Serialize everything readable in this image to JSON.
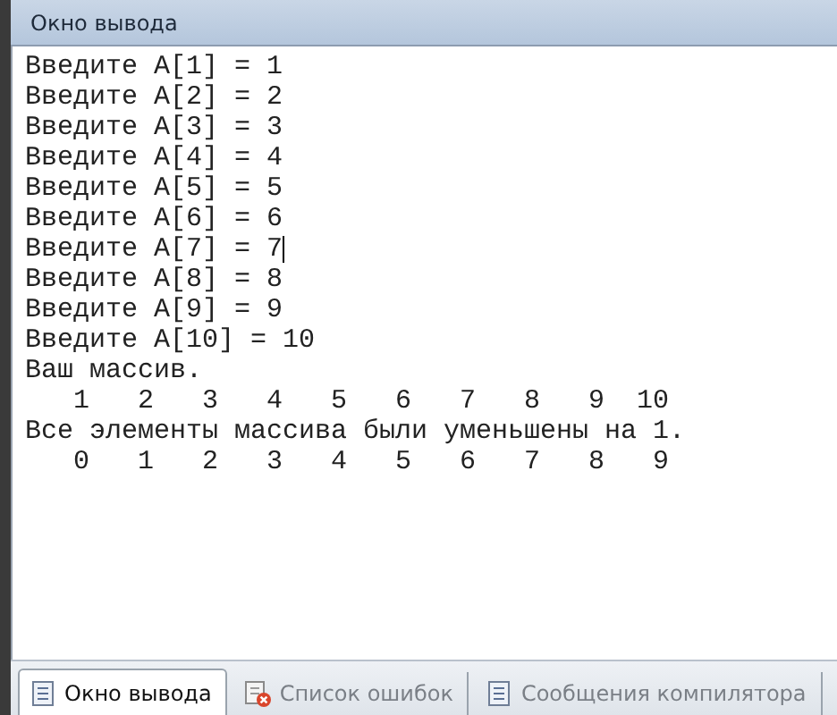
{
  "window": {
    "title": "Окно вывода"
  },
  "console": {
    "lines": [
      {
        "text": "Введите A[1] = 1",
        "cursor": false
      },
      {
        "text": "Введите A[2] = 2",
        "cursor": false
      },
      {
        "text": "Введите A[3] = 3",
        "cursor": false
      },
      {
        "text": "Введите A[4] = 4",
        "cursor": false
      },
      {
        "text": "Введите A[5] = 5",
        "cursor": false
      },
      {
        "text": "Введите A[6] = 6",
        "cursor": false
      },
      {
        "text": "Введите A[7] = 7",
        "cursor": true
      },
      {
        "text": "Введите A[8] = 8",
        "cursor": false
      },
      {
        "text": "Введите A[9] = 9",
        "cursor": false
      },
      {
        "text": "Введите A[10] = 10",
        "cursor": false
      },
      {
        "text": "Ваш массив.",
        "cursor": false
      },
      {
        "text": "   1   2   3   4   5   6   7   8   9  10",
        "cursor": false
      },
      {
        "text": "Все элементы массива были уменьшены на 1.",
        "cursor": false
      },
      {
        "text": "   0   1   2   3   4   5   6   7   8   9",
        "cursor": false
      }
    ]
  },
  "tabs": [
    {
      "label": "Окно вывода",
      "selected": true,
      "kind": "output"
    },
    {
      "label": "Список ошибок",
      "selected": false,
      "kind": "errors"
    },
    {
      "label": "Сообщения компилятора",
      "selected": false,
      "kind": "messages"
    }
  ]
}
